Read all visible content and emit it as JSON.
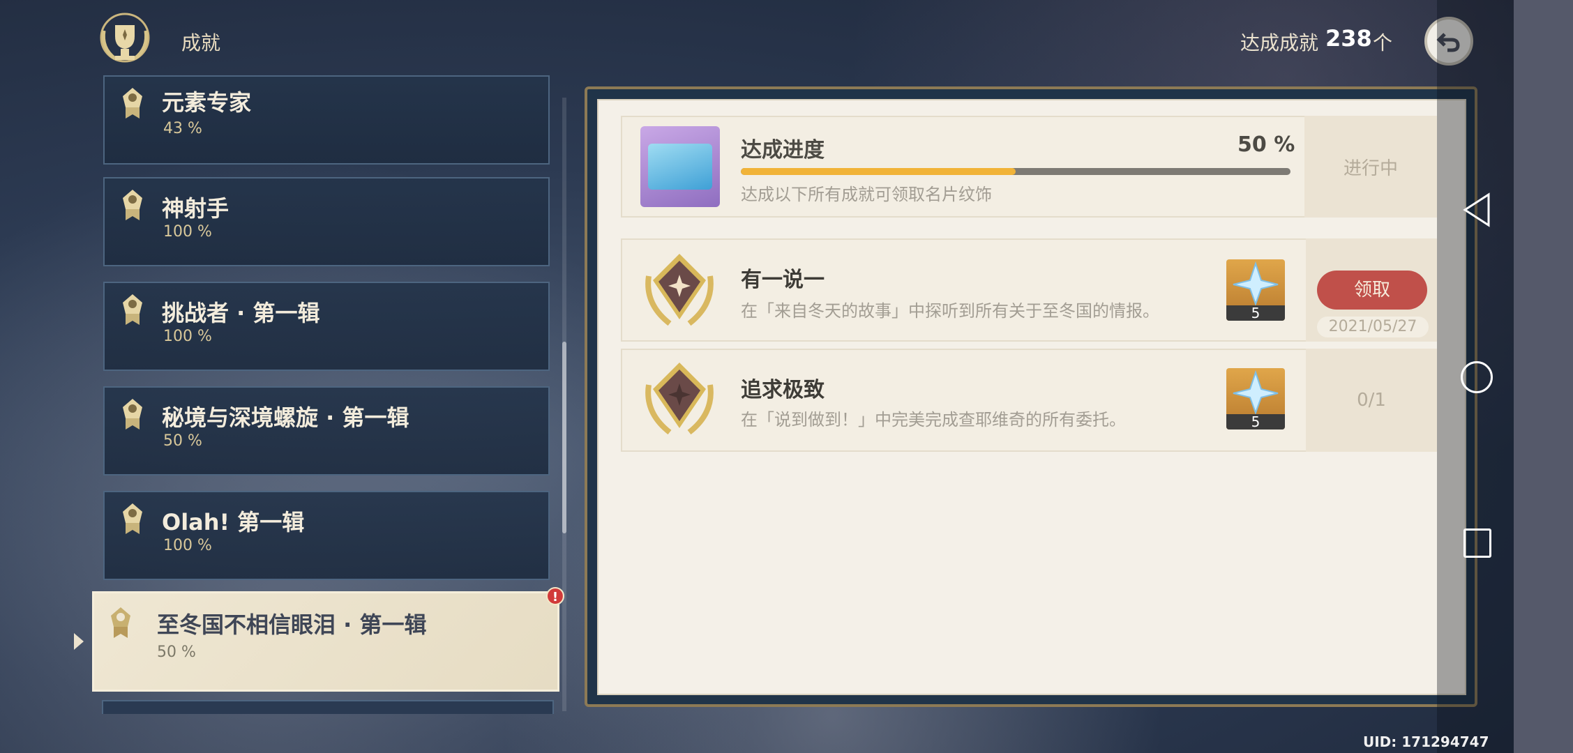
{
  "header": {
    "title": "成就",
    "count_label": "达成成就",
    "count_value": "238",
    "count_unit": "个"
  },
  "categories": [
    {
      "name": "元素专家",
      "percent": "43 %"
    },
    {
      "name": "神射手",
      "percent": "100 %"
    },
    {
      "name": "挑战者 · 第一辑",
      "percent": "100 %"
    },
    {
      "name": "秘境与深境螺旋 · 第一辑",
      "percent": "50 %"
    },
    {
      "name": "Olah! 第一辑",
      "percent": "100 %"
    },
    {
      "name": "至冬国不相信眼泪 · 第一辑",
      "percent": "50 %"
    }
  ],
  "active_category_alert": "!",
  "progress": {
    "title": "达成进度",
    "percent": "50 %",
    "fill_fraction": 0.5,
    "description": "达成以下所有成就可领取名片纹饰",
    "status": "进行中"
  },
  "achievements": [
    {
      "title": "有一说一",
      "description": "在「来自冬天的故事」中探听到所有关于至冬国的情报。",
      "reward_qty": "5",
      "claim_label": "领取",
      "date": "2021/05/27"
    },
    {
      "title": "追求极致",
      "description": "在「说到做到！」中完美完成查耶维奇的所有委托。",
      "reward_qty": "5",
      "progress": "0/1"
    }
  ],
  "footer": {
    "uid": "UID: 171294747"
  },
  "colors": {
    "accent_gold": "#f1b338",
    "claim_red": "#c0504a",
    "panel_bg": "#f4f0e8"
  }
}
